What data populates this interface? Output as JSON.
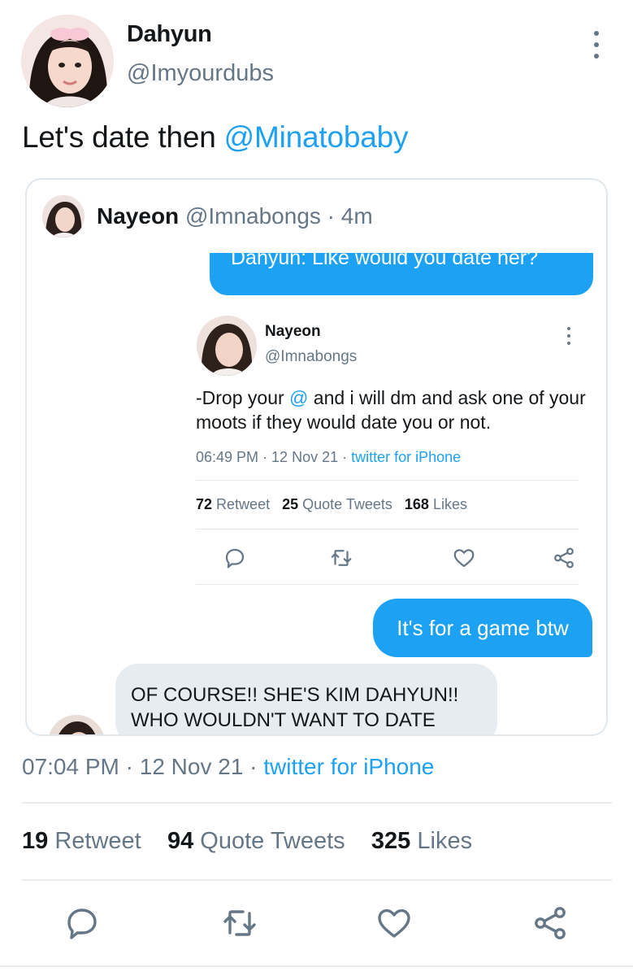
{
  "tweet": {
    "display_name": "Dahyun",
    "handle": "@Imyourdubs",
    "text_prefix": "Let's date then ",
    "mention": "@Minatobaby",
    "time": "07:04 PM",
    "sep1": " · ",
    "date": "12 Nov 21",
    "sep2": " · ",
    "source": "twitter for iPhone",
    "stats": {
      "retweet_count": "19",
      "retweet_label": "Retweet",
      "quote_count": "94",
      "quote_label": "Quote Tweets",
      "likes_count": "325",
      "likes_label": "Likes"
    },
    "actions": [
      "reply-icon",
      "retweet-icon",
      "like-icon",
      "share-icon"
    ]
  },
  "quote": {
    "display_name": "Nayeon",
    "handle": "@Imnabongs",
    "age": " · 4m",
    "chat": {
      "top_bubble_text": "Dahyun: Like would you date her?",
      "embedded_tweet": {
        "display_name": "Nayeon",
        "handle": "@Imnabongs",
        "text_before": "-Drop your ",
        "text_at": "@",
        "text_after": " and i will dm and ask one of your moots if they would date you or not.",
        "time": "06:49 PM",
        "sep1": " · ",
        "date": "12 Nov 21",
        "sep2": " · ",
        "source": "twitter for iPhone",
        "retweet_count": "72",
        "retweet_label": "Retweet",
        "quote_count": "25",
        "quote_label": "Quote Tweets",
        "likes_count": "168",
        "likes_label": "Likes"
      },
      "game_bubble_text": "It's for a game btw",
      "reply_bubble_text": "OF COURSE!! SHE'S KIM DAHYUN!! WHO WOULDN'T WANT TO DATE"
    }
  },
  "colors": {
    "accent": "#1da1f2",
    "text": "#14171a",
    "muted": "#657786",
    "divider": "#e6ecf0",
    "reply_bubble": "#e6ecf0"
  }
}
